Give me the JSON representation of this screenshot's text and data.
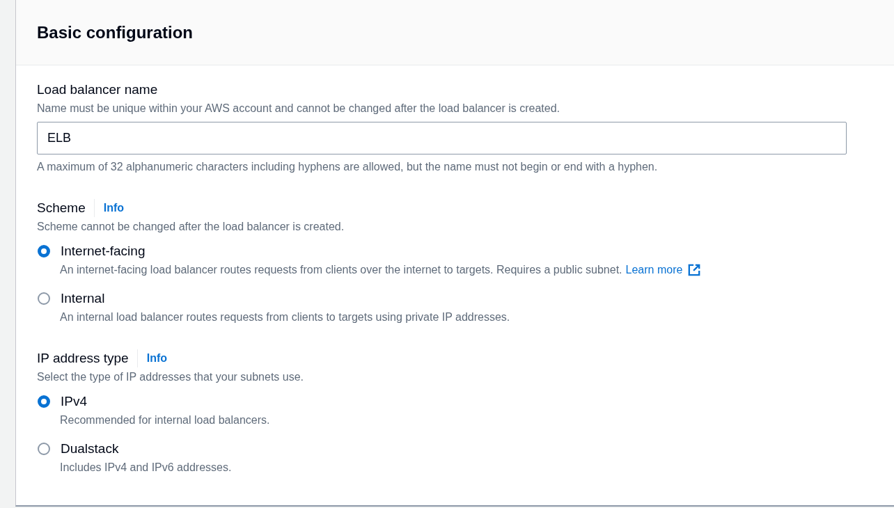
{
  "panel": {
    "title": "Basic configuration"
  },
  "name_field": {
    "label": "Load balancer name",
    "description": "Name must be unique within your AWS account and cannot be changed after the load balancer is created.",
    "value": "ELB",
    "constraint": "A maximum of 32 alphanumeric characters including hyphens are allowed, but the name must not begin or end with a hyphen."
  },
  "groups": [
    {
      "label": "Scheme",
      "info": "Info",
      "description": "Scheme cannot be changed after the load balancer is created.",
      "options": [
        {
          "label": "Internet-facing",
          "description": "An internet-facing load balancer routes requests from clients over the internet to targets. Requires a public subnet.",
          "link": "Learn more",
          "selected": true
        },
        {
          "label": "Internal",
          "description": "An internal load balancer routes requests from clients to targets using private IP addresses.",
          "selected": false
        }
      ]
    },
    {
      "label": "IP address type",
      "info": "Info",
      "description": "Select the type of IP addresses that your subnets use.",
      "options": [
        {
          "label": "IPv4",
          "description": "Recommended for internal load balancers.",
          "selected": true
        },
        {
          "label": "Dualstack",
          "description": "Includes IPv4 and IPv6 addresses.",
          "selected": false
        }
      ]
    }
  ]
}
